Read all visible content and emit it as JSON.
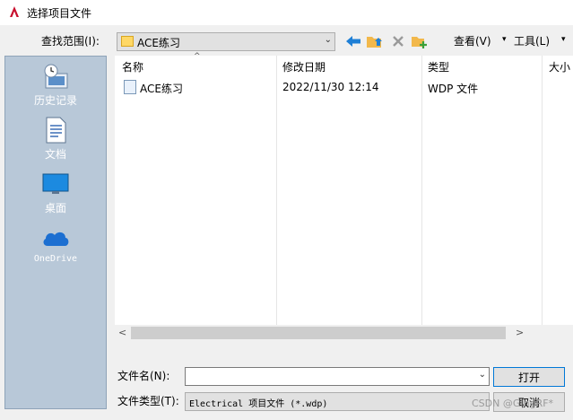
{
  "window": {
    "title": "选择项目文件"
  },
  "lookin": {
    "label": "查找范围(I):",
    "value": "ACE练习"
  },
  "toolbar": {
    "view_label": "查看(V)",
    "tools_label": "工具(L)"
  },
  "places": [
    {
      "label": "历史记录",
      "icon": "history-icon"
    },
    {
      "label": "文档",
      "icon": "document-icon"
    },
    {
      "label": "桌面",
      "icon": "desktop-icon"
    },
    {
      "label": "OneDrive",
      "icon": "onedrive-icon"
    }
  ],
  "filelist": {
    "columns": [
      "名称",
      "修改日期",
      "类型",
      "大小"
    ],
    "rows": [
      {
        "name": "ACE练习",
        "modified": "2022/11/30 12:14",
        "type": "WDP 文件"
      }
    ]
  },
  "filename": {
    "label": "文件名(N):",
    "value": ""
  },
  "filetype": {
    "label": "文件类型(T):",
    "value": "Electrical 项目文件 (*.wdp)"
  },
  "buttons": {
    "open": "打开",
    "cancel": "取消"
  },
  "watermark": "CSDN @GIngRF*",
  "colors": {
    "accent": "#0078d7",
    "places_bg": "#b8c8d8",
    "logo_red": "#c8102e"
  }
}
